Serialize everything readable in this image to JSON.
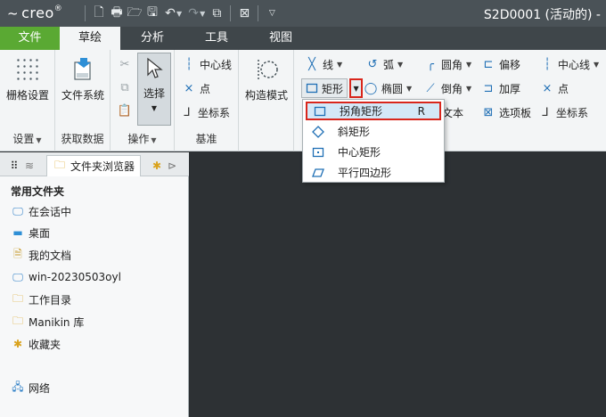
{
  "titlebar": {
    "logo": "creo",
    "doc_title": "S2D0001 (活动的) -"
  },
  "tabs": [
    {
      "label": "文件"
    },
    {
      "label": "草绘"
    },
    {
      "label": "分析"
    },
    {
      "label": "工具"
    },
    {
      "label": "视图"
    }
  ],
  "ribbon": {
    "setup": {
      "grid_settings": "栅格设置",
      "group_label": "设置"
    },
    "get_data": {
      "file_system": "文件系统",
      "group_label": "获取数据"
    },
    "operations": {
      "select": "选择",
      "group_label": "操作"
    },
    "datum": {
      "centerline": "中心线",
      "point": "点",
      "coord_sys": "坐标系",
      "group_label": "基准"
    },
    "construction": {
      "label": "构造模式"
    },
    "sketch": {
      "line": "线",
      "arc": "弧",
      "fillet": "圆角",
      "offset": "偏移",
      "rectangle": "矩形",
      "ellipse": "椭圆",
      "chamfer": "倒角",
      "thicken": "加厚",
      "text": "文本",
      "palette": "选项板",
      "centerline": "中心线",
      "point": "点",
      "coord_sys": "坐标系"
    }
  },
  "rect_menu": {
    "items": [
      {
        "label": "拐角矩形",
        "shortcut": "R"
      },
      {
        "label": "斜矩形"
      },
      {
        "label": "中心矩形"
      },
      {
        "label": "平行四边形"
      }
    ]
  },
  "navigator": {
    "tab_label": "文件夹浏览器",
    "head": "常用文件夹",
    "folders": [
      {
        "label": "在会话中"
      },
      {
        "label": "桌面"
      },
      {
        "label": "我的文档"
      },
      {
        "label": "win-20230503oyl"
      },
      {
        "label": "工作目录"
      },
      {
        "label": "Manikin 库"
      },
      {
        "label": "收藏夹"
      },
      {
        "label": "网络"
      }
    ]
  },
  "colors": {
    "file_tab": "#5aa933",
    "highlight": "#d9261c",
    "accent": "#1f6fb5"
  }
}
